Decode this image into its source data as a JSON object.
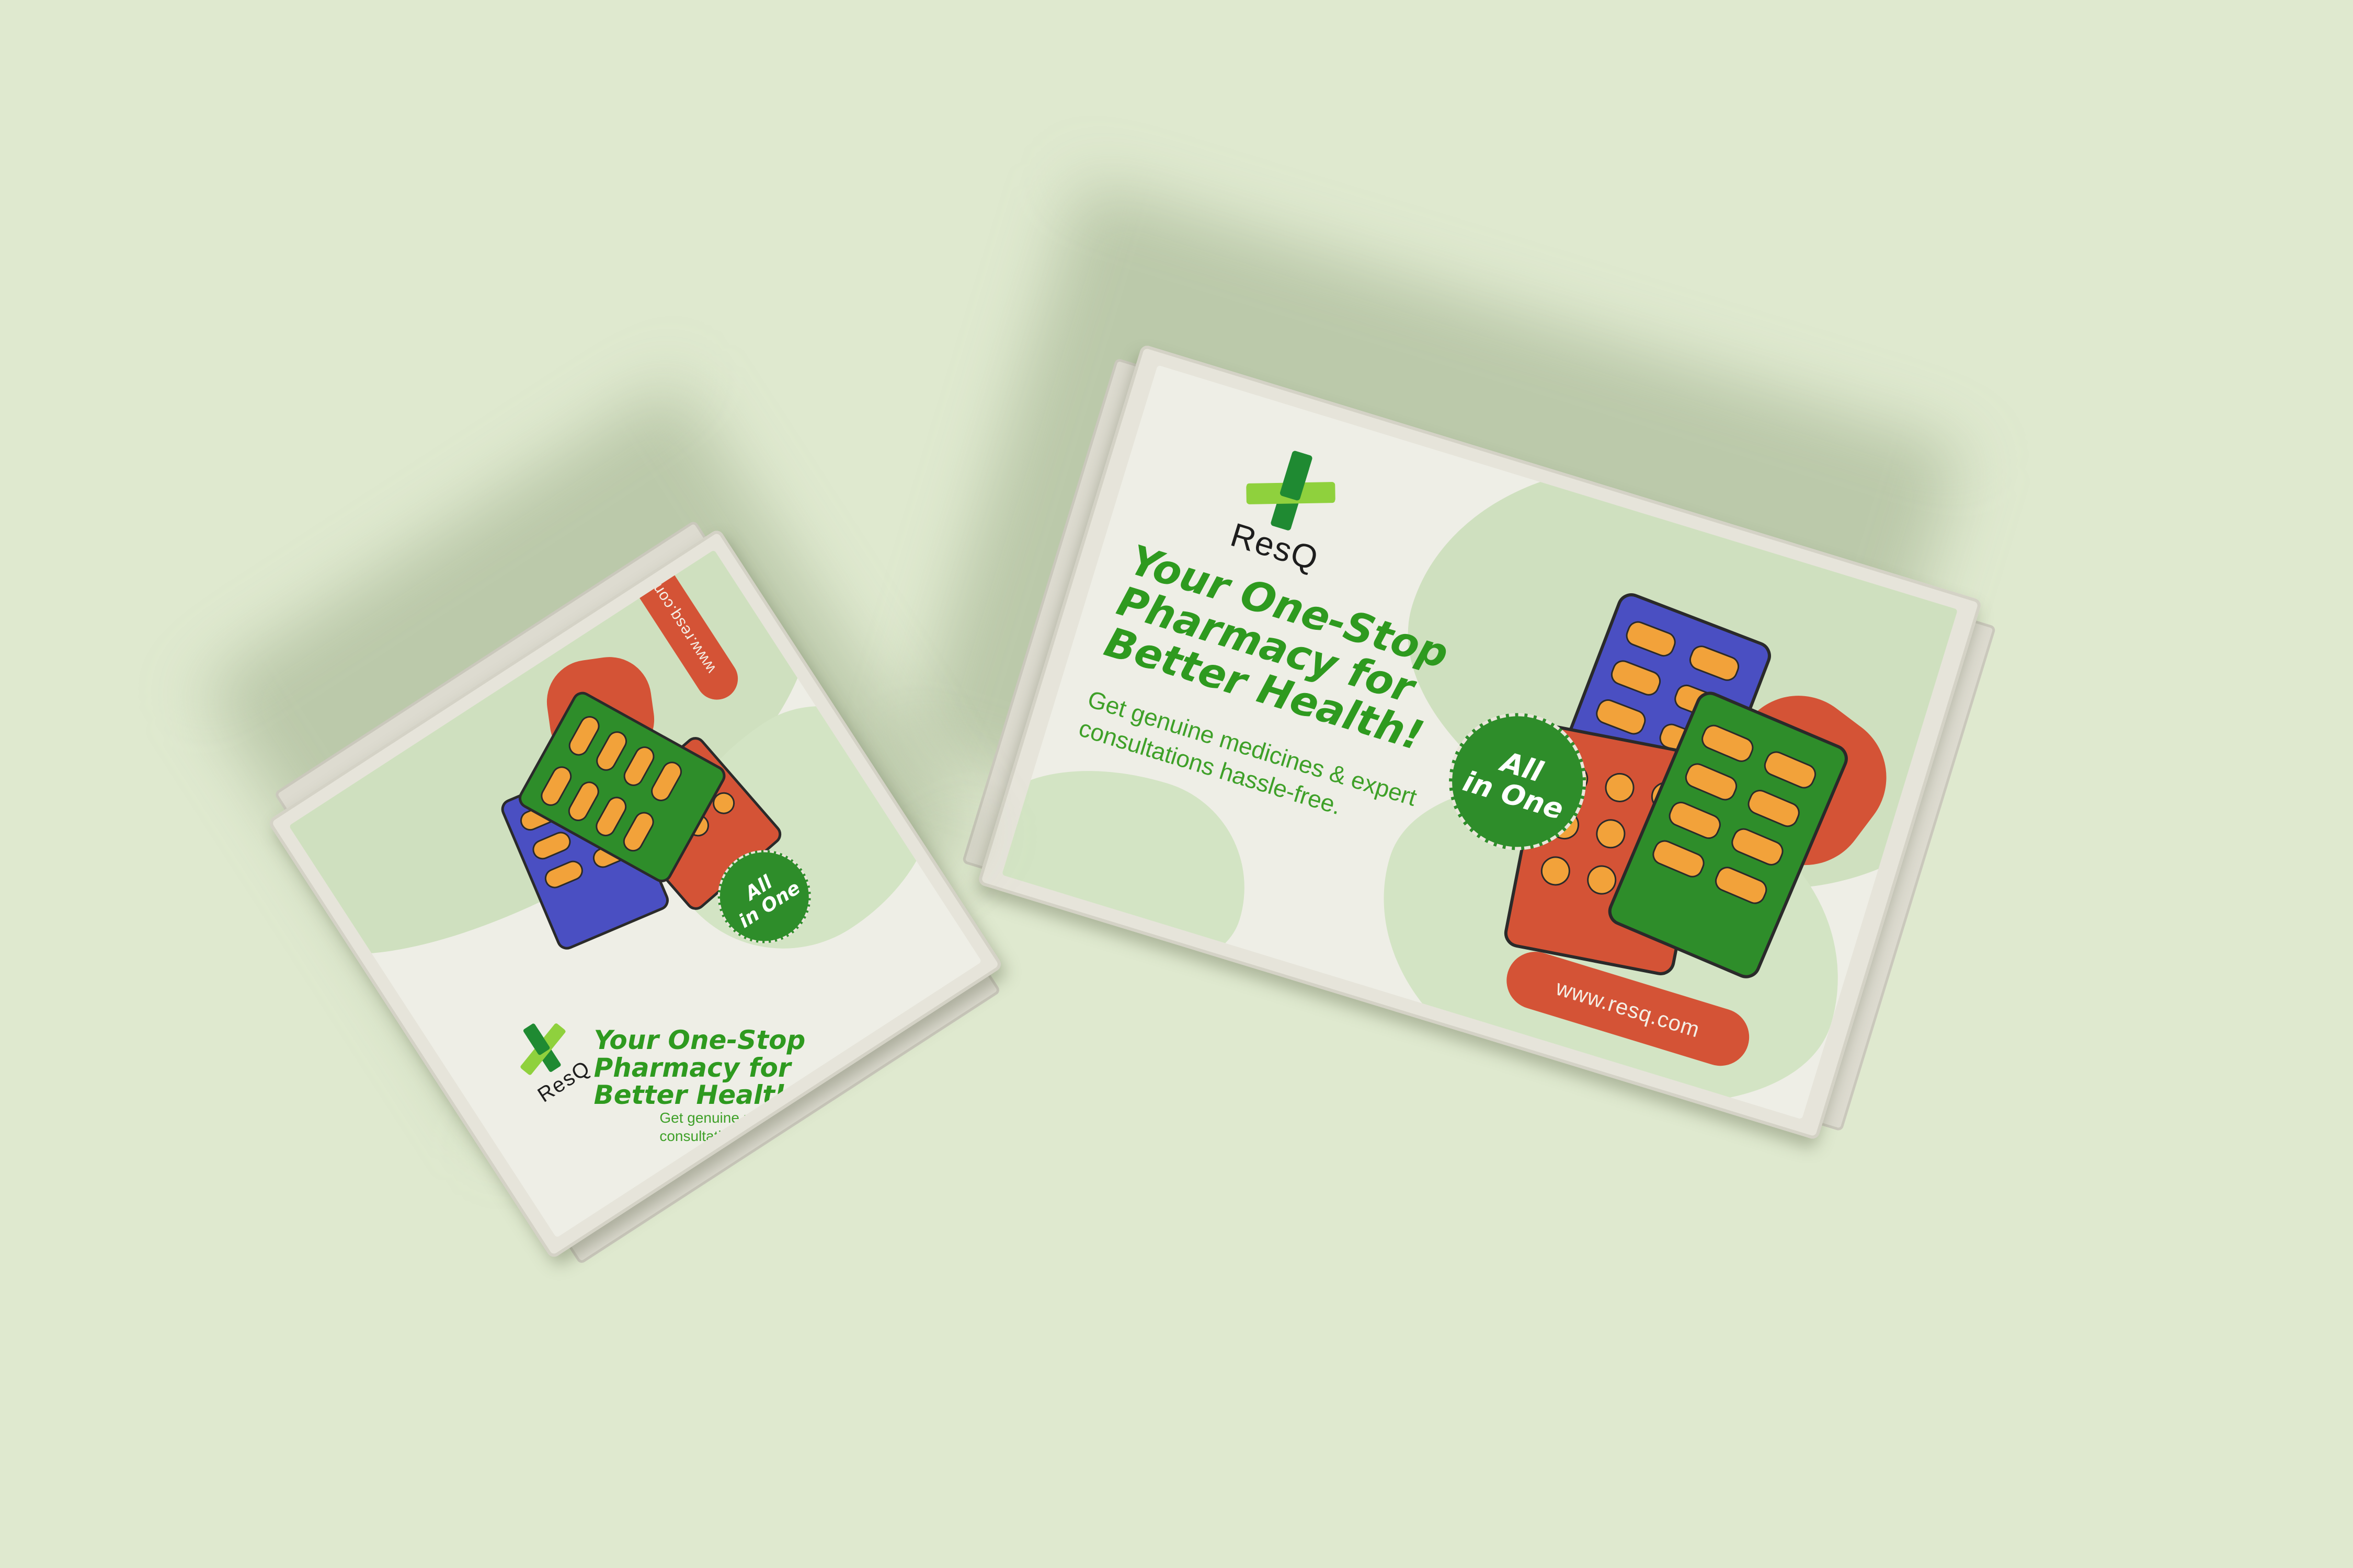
{
  "brand": {
    "name": "ResQ",
    "logo_icon": "green-cross-icon"
  },
  "packaging": {
    "headline": "Your One-Stop\nPharmacy for\nBetter Health!",
    "subtext": "Get genuine medicines & expert\nconsultations hassle-free.",
    "badge": "All\nin One",
    "url": "www.resq.com"
  },
  "colors": {
    "background": "#dfe9cf",
    "brand_green": "#2e9a1f",
    "accent_red": "#d45336",
    "blister_blue": "#4a4fc2",
    "pill_orange": "#f2a23a"
  }
}
